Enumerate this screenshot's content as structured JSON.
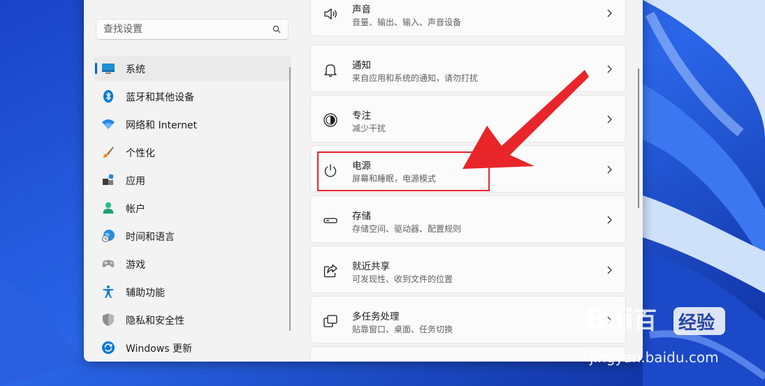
{
  "search": {
    "placeholder": "查找设置"
  },
  "nav": {
    "items": [
      {
        "label": "系统",
        "icon": "monitor-icon",
        "selected": true
      },
      {
        "label": "蓝牙和其他设备",
        "icon": "bluetooth-icon"
      },
      {
        "label": "网络和 Internet",
        "icon": "wifi-icon"
      },
      {
        "label": "个性化",
        "icon": "brush-icon"
      },
      {
        "label": "应用",
        "icon": "apps-icon"
      },
      {
        "label": "帐户",
        "icon": "person-icon"
      },
      {
        "label": "时间和语言",
        "icon": "globe-clock-icon"
      },
      {
        "label": "游戏",
        "icon": "gamepad-icon"
      },
      {
        "label": "辅助功能",
        "icon": "accessibility-icon"
      },
      {
        "label": "隐私和安全性",
        "icon": "shield-icon"
      },
      {
        "label": "Windows 更新",
        "icon": "update-icon"
      }
    ]
  },
  "panel": {
    "cards": [
      {
        "title": "声音",
        "subtitle": "音量、输出、输入、声音设备",
        "icon": "speaker-icon"
      },
      {
        "title": "通知",
        "subtitle": "来自应用和系统的通知，请勿打扰",
        "icon": "bell-icon"
      },
      {
        "title": "专注",
        "subtitle": "减少干扰",
        "icon": "focus-icon"
      },
      {
        "title": "电源",
        "subtitle": "屏幕和睡眠，电源模式",
        "icon": "power-icon"
      },
      {
        "title": "存储",
        "subtitle": "存储空间、驱动器、配置规则",
        "icon": "storage-icon"
      },
      {
        "title": "就近共享",
        "subtitle": "可发现性、收到文件的位置",
        "icon": "share-icon"
      },
      {
        "title": "多任务处理",
        "subtitle": "贴靠窗口、桌面、任务切换",
        "icon": "multitask-icon"
      }
    ]
  },
  "watermark": {
    "brand": "Bai",
    "brand2": "百",
    "tag": "经验",
    "url": "jingyan.baidu.com"
  },
  "colors": {
    "accent": "#0067c0",
    "highlight": "#e8262a",
    "wallpaper": "#1d4fd0"
  }
}
